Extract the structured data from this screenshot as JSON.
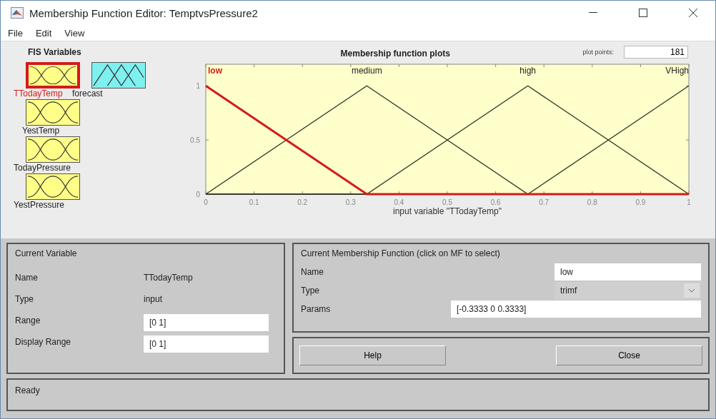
{
  "window": {
    "title": "Membership Function Editor: TemptvsPressure2"
  },
  "menu": [
    "File",
    "Edit",
    "View"
  ],
  "fis_variables": {
    "title": "FIS Variables",
    "items": [
      {
        "name": "TTodayTemp",
        "kind": "input",
        "selected": true
      },
      {
        "name": "forecast",
        "kind": "output",
        "selected": false
      },
      {
        "name": "YestTemp",
        "kind": "input",
        "selected": false
      },
      {
        "name": "TodayPressure",
        "kind": "input",
        "selected": false
      },
      {
        "name": "YestPressure",
        "kind": "input",
        "selected": false
      }
    ]
  },
  "plot": {
    "plot_points_label": "plot points:",
    "plot_points": "181",
    "chart_data": {
      "type": "line",
      "title": "Membership function plots",
      "xlabel": "input variable \"TTodayTemp\"",
      "x": [
        0,
        0.3333,
        0.6667,
        1
      ],
      "series": [
        {
          "name": "low",
          "color": "#d41a1a",
          "values": [
            1,
            0,
            0,
            0
          ]
        },
        {
          "name": "medium",
          "color": "#333322",
          "values": [
            0,
            1,
            0,
            0
          ]
        },
        {
          "name": "high",
          "color": "#333322",
          "values": [
            0,
            0,
            1,
            0
          ]
        },
        {
          "name": "VHigh",
          "color": "#333322",
          "values": [
            0,
            0,
            0,
            1
          ]
        }
      ],
      "xlim": [
        0,
        1
      ],
      "ylim": [
        0,
        1.2
      ],
      "xticks": [
        0,
        0.1,
        0.2,
        0.3,
        0.4,
        0.5,
        0.6,
        0.7,
        0.8,
        0.9,
        1
      ],
      "yticks": [
        0,
        0.5,
        1
      ]
    },
    "mf_states": [
      {
        "selected": true
      },
      {
        "selected": false
      },
      {
        "selected": false
      },
      {
        "selected": false
      }
    ]
  },
  "current_variable": {
    "title": "Current Variable",
    "rows": [
      {
        "label": "Name",
        "value": "TTodayTemp",
        "kind": "text"
      },
      {
        "label": "Type",
        "value": "input",
        "kind": "text"
      },
      {
        "label": "Range",
        "value": "[0 1]",
        "kind": "field"
      },
      {
        "label": "Display Range",
        "value": "[0 1]",
        "kind": "field"
      }
    ]
  },
  "current_mf": {
    "title": "Current Membership Function (click on MF to select)",
    "rows": [
      {
        "label": "Name",
        "value": "low",
        "kind": "field"
      },
      {
        "label": "Type",
        "value": "trimf",
        "kind": "dropdown"
      },
      {
        "label": "Params",
        "value": "[-0.3333 0 0.3333]",
        "kind": "wide_field"
      }
    ]
  },
  "buttons": [
    "Help",
    "Close"
  ],
  "status_bar": "Ready"
}
